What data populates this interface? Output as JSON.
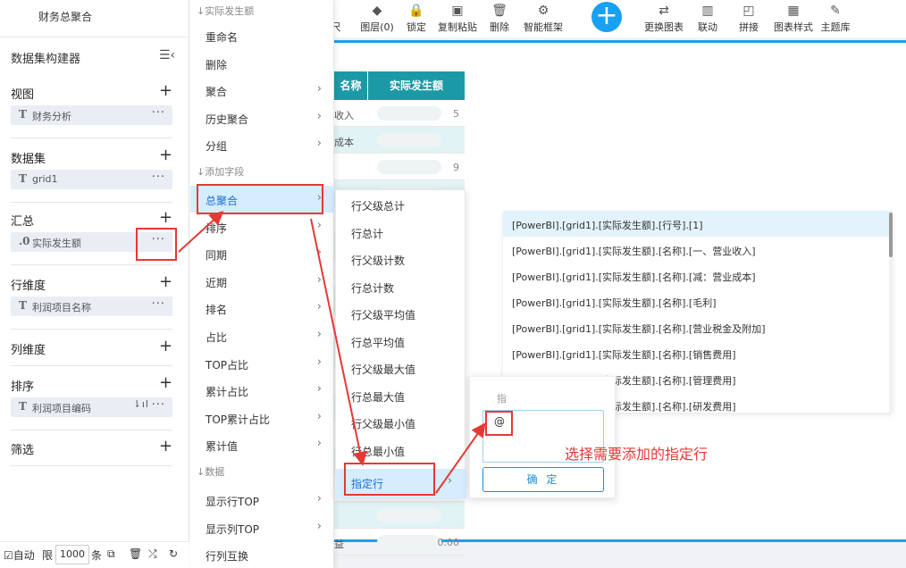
{
  "app": {
    "title": "财务总聚合"
  },
  "builder": {
    "header": "数据集构建器",
    "sections": [
      {
        "label": "视图",
        "item": {
          "type": "T",
          "text": "财务分析"
        }
      },
      {
        "label": "数据集",
        "item": {
          "type": "T",
          "text": "grid1"
        }
      },
      {
        "label": "汇总",
        "item": {
          "type": ".0",
          "text": "实际发生额"
        }
      },
      {
        "label": "行维度",
        "item": {
          "type": "T",
          "text": "利润项目名称"
        }
      },
      {
        "label": "列维度"
      },
      {
        "label": "排序",
        "item": {
          "type": "T",
          "text": "利润项目编码"
        }
      },
      {
        "label": "筛选"
      }
    ],
    "footer": {
      "auto": "☑自动",
      "limit_label": "限",
      "limit_value": "1000",
      "unit": "条"
    }
  },
  "menu1": {
    "group1": "实际发生额",
    "items1": [
      {
        "label": "重命名",
        "arrow": false
      },
      {
        "label": "删除",
        "arrow": false
      },
      {
        "label": "聚合",
        "arrow": true
      },
      {
        "label": "历史聚合",
        "arrow": true
      },
      {
        "label": "分组",
        "arrow": true
      }
    ],
    "group2": "添加字段",
    "items2": [
      {
        "label": "总聚合",
        "arrow": true
      },
      {
        "label": "排序",
        "arrow": true
      },
      {
        "label": "同期",
        "arrow": true
      },
      {
        "label": "近期",
        "arrow": true
      },
      {
        "label": "排名",
        "arrow": true
      },
      {
        "label": "占比",
        "arrow": true
      },
      {
        "label": "TOP占比",
        "arrow": true
      },
      {
        "label": "累计占比",
        "arrow": true
      },
      {
        "label": "TOP累计占比",
        "arrow": true
      },
      {
        "label": "累计值",
        "arrow": true
      }
    ],
    "group3": "数据",
    "items3": [
      {
        "label": "显示行TOP",
        "arrow": true
      },
      {
        "label": "显示列TOP",
        "arrow": true
      },
      {
        "label": "行列互换",
        "arrow": false
      }
    ]
  },
  "menu2": {
    "items": [
      "行父级总计",
      "行总计",
      "行父级计数",
      "行总计数",
      "行父级平均值",
      "行总平均值",
      "行父级最大值",
      "行总最大值",
      "行父级最小值",
      "行总最小值",
      "指定行"
    ]
  },
  "toolbar": {
    "items": [
      {
        "label": "尺",
        "icon": "ruler-icon"
      },
      {
        "label": "图层(0)",
        "icon": "layers-icon"
      },
      {
        "label": "锁定",
        "icon": "lock-icon"
      },
      {
        "label": "复制粘贴",
        "icon": "copy-icon"
      },
      {
        "label": "删除",
        "icon": "trash-icon"
      },
      {
        "label": "智能框架",
        "icon": "smart-frame-icon"
      },
      {
        "label": "更换图表",
        "icon": "swap-chart-icon"
      },
      {
        "label": "联动",
        "icon": "link-icon"
      },
      {
        "label": "拼接",
        "icon": "merge-icon"
      },
      {
        "label": "图表样式",
        "icon": "chart-style-icon"
      },
      {
        "label": "主题库",
        "icon": "brush-icon"
      }
    ],
    "add": "+"
  },
  "grid": {
    "headers": [
      "名称",
      "实际发生额"
    ],
    "rows": [
      {
        "c1": "收入",
        "c2": "5"
      },
      {
        "c1": "成本",
        "c2": ""
      },
      {
        "c1": "",
        "c2": "9"
      },
      {
        "c1": "",
        "c2": ""
      },
      {
        "c1": "",
        "c2": ""
      },
      {
        "c1": "",
        "c2": ""
      },
      {
        "c1": "",
        "c2": ""
      },
      {
        "c1": "",
        "c2": ""
      },
      {
        "c1": "",
        "c2": ""
      },
      {
        "c1": "",
        "c2": ""
      },
      {
        "c1": "",
        "c2": ""
      },
      {
        "c1": "",
        "c2": ""
      },
      {
        "c1": "",
        "c2": ""
      },
      {
        "c1": "",
        "c2": ""
      },
      {
        "c1": "",
        "c2": ""
      },
      {
        "c1": "",
        "c2": ""
      },
      {
        "c1": "益",
        "c2": "0.00"
      }
    ]
  },
  "suggestions": [
    "[PowerBI].[grid1].[实际发生额].[行号].[1]",
    "[PowerBI].[grid1].[实际发生额].[名称].[一、营业收入]",
    "[PowerBI].[grid1].[实际发生额].[名称].[减：营业成本]",
    "[PowerBI].[grid1].[实际发生额].[名称].[毛利]",
    "[PowerBI].[grid1].[实际发生额].[名称].[营业税金及附加]",
    "[PowerBI].[grid1].[实际发生额].[名称].[销售费用]",
    "[PowerBI].[grid1].[实际发生额].[名称].[管理费用]",
    "[PowerBI].[grid1].[实际发生额].[名称].[研发费用]"
  ],
  "popup": {
    "label": "指",
    "value": "@",
    "ok": "确 定"
  },
  "annotation": "选择需要添加的指定行",
  "colors": {
    "accent": "#1aa0f0",
    "teal": "#1b9aa6",
    "red": "#e53935"
  }
}
